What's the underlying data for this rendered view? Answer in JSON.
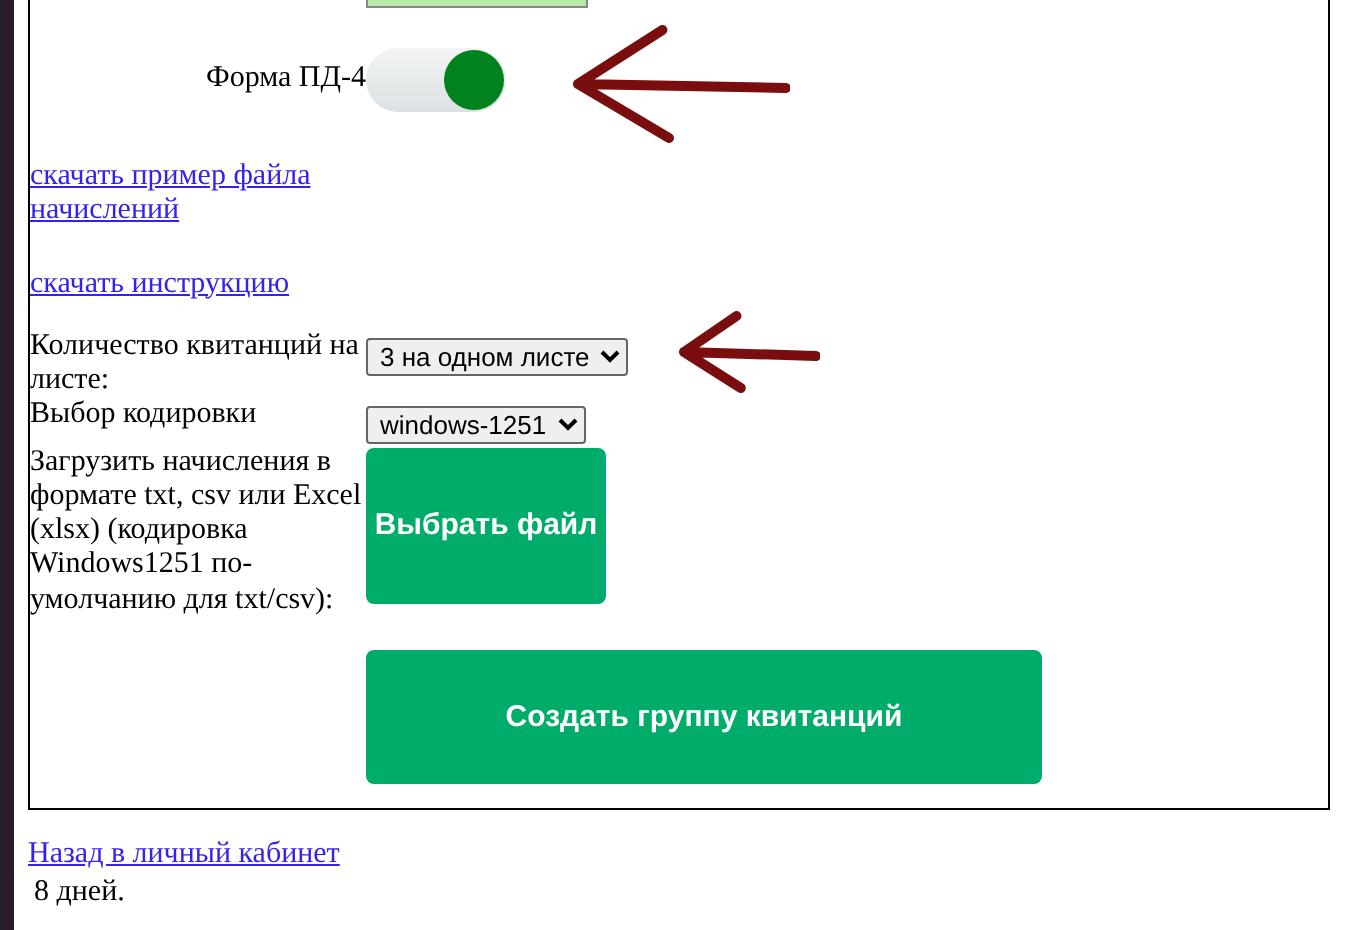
{
  "form": {
    "toggle": {
      "label": "Форма ПД-4",
      "on": true
    },
    "links": [
      "скачать пример файла начислений",
      "скачать инструкцию"
    ],
    "fields": [
      {
        "kind": "select",
        "label": "Количество квитанций на листе:",
        "value": "3 на одном листе"
      },
      {
        "kind": "select",
        "label": "Выбор кодировки",
        "value": "windows-1251"
      },
      {
        "kind": "file",
        "label": "Загрузить начисления в формате txt, csv или Excel (xlsx) (кодировка Windows1251 по-умолчанию для txt/csv):",
        "button": "Выбрать файл"
      }
    ],
    "submit": "Создать группу квитанций"
  },
  "back_link": "Назад в личный кабинет",
  "footer_text": "8 дней."
}
